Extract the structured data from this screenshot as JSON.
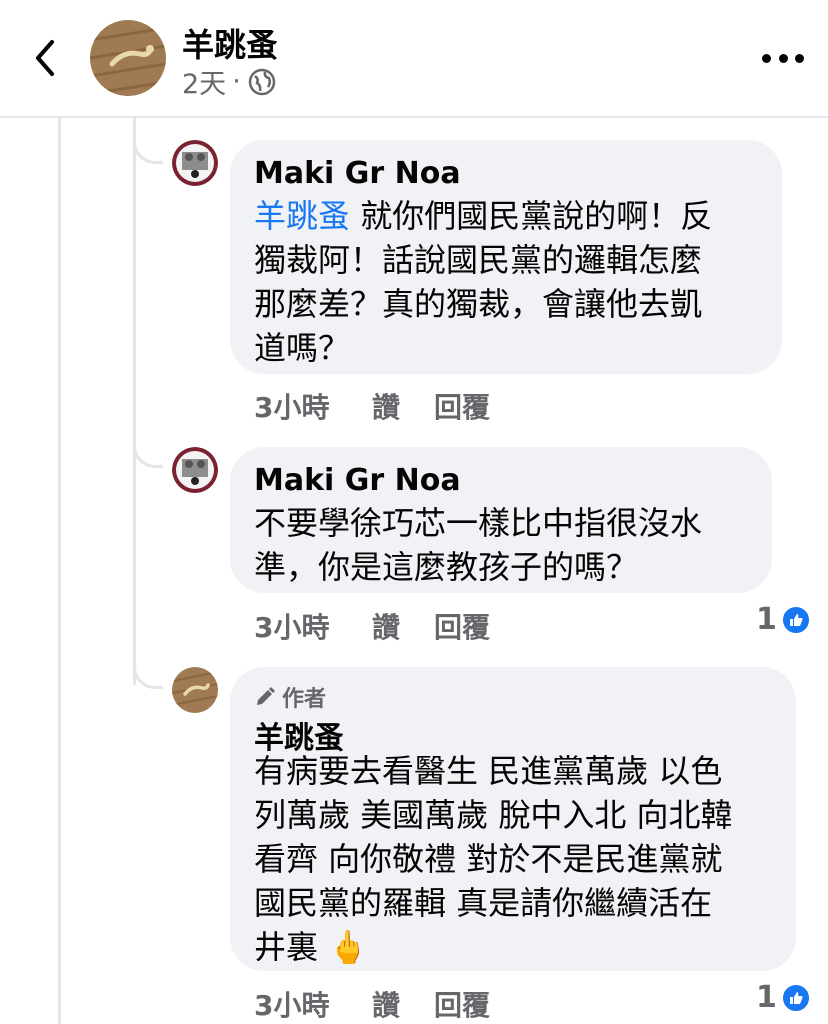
{
  "post_header": {
    "author": "羊跳蚤",
    "time": "2天",
    "separator": "·",
    "privacy_icon": "globe-icon",
    "back_icon": "chevron-left-icon",
    "menu_icon": "more-horizontal-icon"
  },
  "comments": [
    {
      "author": "Maki Gr Noa",
      "mention": "羊跳蚤",
      "text_lines": [
        "就你們國民黨說的啊！反",
        "獨裁阿！話說國民黨的邏輯怎麼",
        "那麼差？真的獨裁，會讓他去凱",
        "道嗎？"
      ],
      "time": "3小時",
      "like_label": "讚",
      "reply_label": "回覆"
    },
    {
      "author": "Maki Gr Noa",
      "text_lines": [
        "不要學徐巧芯一樣比中指很沒水",
        "準，你是這麼教孩子的嗎？"
      ],
      "time": "3小時",
      "like_label": "讚",
      "reply_label": "回覆",
      "reaction_count": "1",
      "reaction_icon": "like-icon"
    },
    {
      "author_badge": "作者",
      "author_badge_icon": "pencil-icon",
      "author": "羊跳蚤",
      "text_lines": [
        "有病要去看醫生 民進黨萬歲 以色",
        "列萬歲 美國萬歲 脫中入北 向北韓",
        "看齊 向你敬禮 對於不是民進黨就",
        "國民黨的羅輯 真是請你繼續活在",
        "井裏 🖕"
      ],
      "time": "3小時",
      "like_label": "讚",
      "reply_label": "回覆",
      "reaction_count": "1",
      "reaction_icon": "like-icon"
    }
  ],
  "colors": {
    "bubble_bg": "#f0f2f5",
    "mention": "#1877f2",
    "secondary_text": "#65676b",
    "like_blue": "#1877f2"
  }
}
